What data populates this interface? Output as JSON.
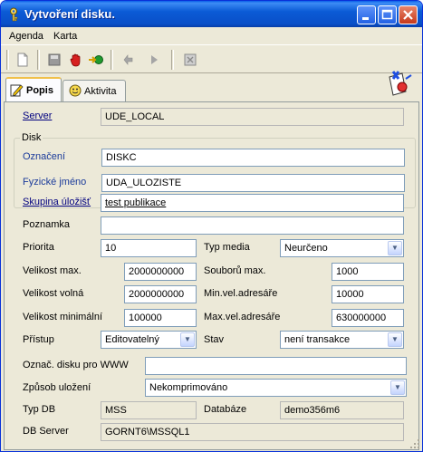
{
  "window": {
    "title": "Vytvoření disku.",
    "minimize": "_",
    "maximize": "□",
    "close": "✕"
  },
  "menu": [
    "Agenda",
    "Karta"
  ],
  "toolbar": {
    "icons": [
      "new-document-icon",
      "save-disk-icon",
      "stop-hand-icon",
      "arrow-in-icon",
      "back-hand-icon",
      "play-icon",
      "delete-icon"
    ]
  },
  "tabs": [
    {
      "label": "Popis",
      "icon": "edit-icon"
    },
    {
      "label": "Aktivita",
      "icon": "activity-icon"
    }
  ],
  "form": {
    "server_label": "Server",
    "server_value": "UDE_LOCAL",
    "disk_group": "Disk",
    "oznaceni_label": "Označení",
    "oznaceni_value": "DISKC",
    "fyzicke_label": "Fyzické jméno",
    "fyzicke_value": "UDA_ULOZISTE",
    "skupina_label": "Skupina úložišť",
    "skupina_value": "test publikace",
    "poznamka_label": "Poznamka",
    "poznamka_value": "",
    "priorita_label": "Priorita",
    "priorita_value": "10",
    "typ_media_label": "Typ media",
    "typ_media_value": "Neurčeno",
    "velikost_max_label": "Velikost max.",
    "velikost_max_value": "2000000000",
    "souboru_max_label": "Souborů max.",
    "souboru_max_value": "1000",
    "velikost_volna_label": "Velikost volná",
    "velikost_volna_value": "2000000000",
    "min_vel_label": "Min.vel.adresáře",
    "min_vel_value": "10000",
    "velikost_min_label": "Velikost minimální",
    "velikost_min_value": "100000",
    "max_vel_label": "Max.vel.adresáře",
    "max_vel_value": "630000000",
    "pristup_label": "Přístup",
    "pristup_value": "Editovatelný",
    "stav_label": "Stav",
    "stav_value": "není transakce",
    "www_label": "Označ. disku pro WWW",
    "www_value": "",
    "zpusob_label": "Způsob uložení",
    "zpusob_value": "Nekomprimováno",
    "typ_db_label": "Typ DB",
    "typ_db_value": "MSS",
    "databaze_label": "Databáze",
    "databaze_value": "demo356m6",
    "db_server_label": "DB Server",
    "db_server_value": "GORNT6\\MSSQL1"
  },
  "colors": {
    "title_bar": "#0a5fe8",
    "window_bg": "#ece9d8",
    "link": "#00007f"
  }
}
